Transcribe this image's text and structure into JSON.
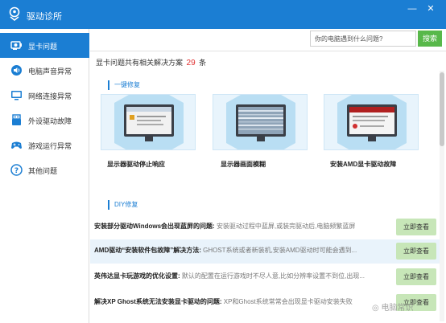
{
  "window": {
    "title": "驱动诊所",
    "minimize_icon": "minimize-icon",
    "close_icon": "close-icon"
  },
  "sidebar": {
    "items": [
      {
        "label": "显卡问题",
        "icon": "gpu-icon",
        "active": true
      },
      {
        "label": "电脑声音异常",
        "icon": "speaker-icon"
      },
      {
        "label": "网络连接异常",
        "icon": "monitor-icon"
      },
      {
        "label": "外设驱动故障",
        "icon": "usb-icon"
      },
      {
        "label": "游戏运行异常",
        "icon": "gamepad-icon"
      },
      {
        "label": "其他问题",
        "icon": "help-icon"
      }
    ]
  },
  "search": {
    "placeholder": "你的电脑遇到什么问题?",
    "button_label": "搜索"
  },
  "summary": {
    "prefix": "显卡问题共有相关解决方案",
    "count": "29",
    "suffix": "条"
  },
  "quick_fix": {
    "header": "一键修复",
    "cards": [
      {
        "label": "显示器驱动停止响应"
      },
      {
        "label": "显示器画面模糊"
      },
      {
        "label": "安装AMD显卡驱动故障"
      }
    ]
  },
  "diy": {
    "header": "DIY修复",
    "issues": [
      {
        "title": "安装部分驱动Windows会出现蓝屏的问题:",
        "desc": "安装驱动过程中蓝屏,或装完驱动后,电脑频繁蓝屏",
        "button": "立即查看"
      },
      {
        "title": "AMD驱动“安装软件包故障”解决方法:",
        "desc": "GHOST系统或者新装机,安装AMD驱动时可能会遇到...",
        "button": "立即查看"
      },
      {
        "title": "英伟达显卡玩游戏的优化设置:",
        "desc": "默认的配置在运行游戏时不尽人意,比如分辨率设置不到位,出现...",
        "button": "立即查看"
      },
      {
        "title": "解决XP Ghost系统无法安装显卡驱动的问题:",
        "desc": "XP和Ghost系统常常会出现显卡驱动安装失败",
        "button": "立即查看"
      }
    ]
  },
  "watermark": "电脑常识",
  "colors": {
    "primary": "#1b7ed3",
    "search_button": "#58b84a",
    "view_button": "#c7e6b8",
    "count": "#e03030"
  }
}
